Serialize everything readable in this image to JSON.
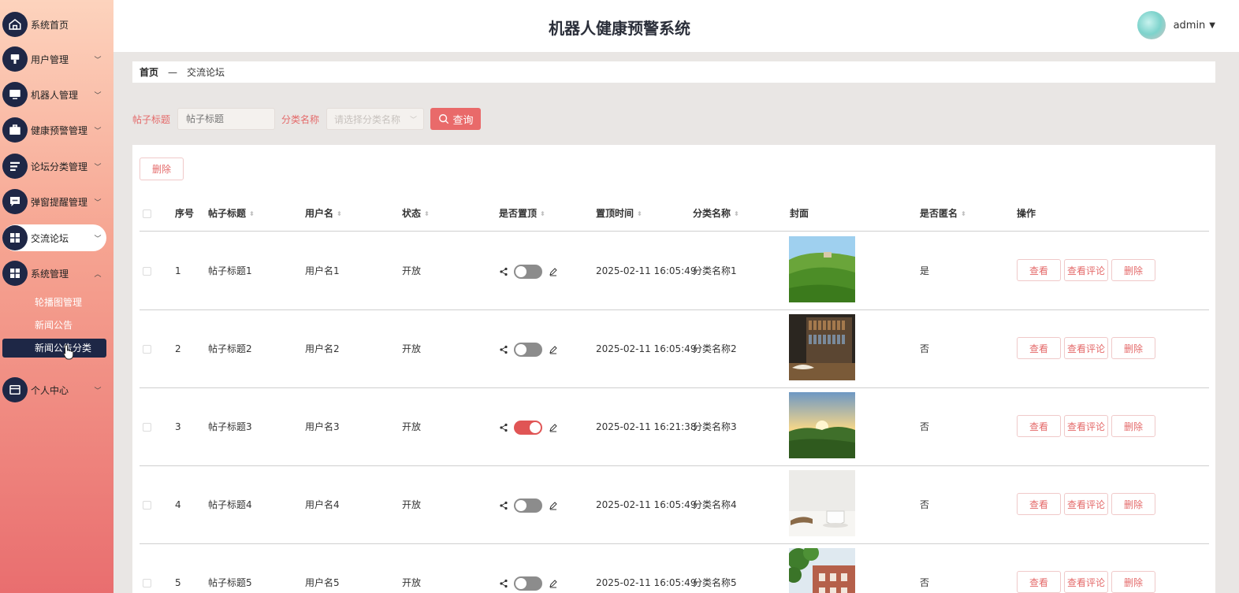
{
  "app": {
    "title": "机器人健康预警系统",
    "user": "admin"
  },
  "sidebar": {
    "items": [
      {
        "label": "系统首页",
        "icon": "home-icon"
      },
      {
        "label": "用户管理",
        "icon": "user-icon"
      },
      {
        "label": "机器人管理",
        "icon": "monitor-icon"
      },
      {
        "label": "健康预警管理",
        "icon": "briefcase-icon"
      },
      {
        "label": "论坛分类管理",
        "icon": "list-icon"
      },
      {
        "label": "弹窗提醒管理",
        "icon": "chat-icon"
      },
      {
        "label": "交流论坛",
        "icon": "grid-icon"
      },
      {
        "label": "系统管理",
        "icon": "grid-icon"
      },
      {
        "label": "个人中心",
        "icon": "card-icon"
      }
    ],
    "sub_items": [
      "轮播图管理",
      "新闻公告",
      "新闻公告分类"
    ]
  },
  "breadcrumb": {
    "home": "首页",
    "sep": "—",
    "current": "交流论坛"
  },
  "search": {
    "title_label": "帖子标题",
    "title_placeholder": "帖子标题",
    "category_label": "分类名称",
    "category_placeholder": "请选择分类名称",
    "button": "查询"
  },
  "table": {
    "delete_label": "删除",
    "headers": {
      "index": "序号",
      "title": "帖子标题",
      "user": "用户名",
      "status": "状态",
      "top": "是否置顶",
      "top_time": "置顶时间",
      "category": "分类名称",
      "cover": "封面",
      "anonymous": "是否匿名",
      "ops": "操作"
    },
    "ops": {
      "view": "查看",
      "comments": "查看评论",
      "delete": "删除"
    },
    "rows": [
      {
        "index": "1",
        "title": "帖子标题1",
        "user": "用户名1",
        "status": "开放",
        "top_on": false,
        "top_time": "2025-02-11 16:05:49",
        "category": "分类名称1",
        "anonymous": "是",
        "cover": "hillside-landscape"
      },
      {
        "index": "2",
        "title": "帖子标题2",
        "user": "用户名2",
        "status": "开放",
        "top_on": false,
        "top_time": "2025-02-11 16:05:49",
        "category": "分类名称2",
        "anonymous": "否",
        "cover": "library-book"
      },
      {
        "index": "3",
        "title": "帖子标题3",
        "user": "用户名3",
        "status": "开放",
        "top_on": true,
        "top_time": "2025-02-11 16:21:38",
        "category": "分类名称3",
        "anonymous": "否",
        "cover": "sunrise-field"
      },
      {
        "index": "4",
        "title": "帖子标题4",
        "user": "用户名4",
        "status": "开放",
        "top_on": false,
        "top_time": "2025-02-11 16:05:49",
        "category": "分类名称4",
        "anonymous": "否",
        "cover": "coffee-book"
      },
      {
        "index": "5",
        "title": "帖子标题5",
        "user": "用户名5",
        "status": "开放",
        "top_on": false,
        "top_time": "2025-02-11 16:05:49",
        "category": "分类名称5",
        "anonymous": "否",
        "cover": "building-tree"
      }
    ]
  },
  "colors": {
    "accent": "#e96a6a",
    "nav_dark": "#1e2746",
    "toggle_on": "#e05555",
    "toggle_off": "#8c8c8c"
  }
}
